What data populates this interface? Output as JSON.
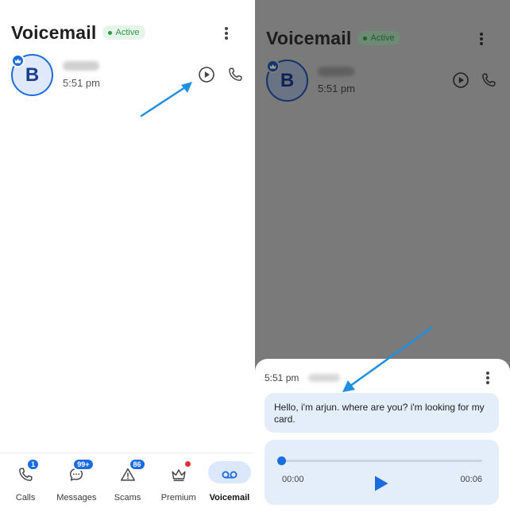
{
  "left_screen": {
    "header": {
      "title": "Voicemail",
      "status_badge": "Active"
    },
    "voicemail_item": {
      "avatar_initial": "B",
      "time": "5:51 pm"
    },
    "tabs": [
      {
        "label": "Calls",
        "badge": "1"
      },
      {
        "label": "Messages",
        "badge": "99+"
      },
      {
        "label": "Scams",
        "badge": "86"
      },
      {
        "label": "Premium"
      },
      {
        "label": "Voicemail",
        "active": true
      }
    ]
  },
  "right_screen": {
    "header": {
      "title": "Voicemail",
      "status_badge": "Active"
    },
    "voicemail_item": {
      "avatar_initial": "B",
      "time": "5:51 pm"
    },
    "sheet": {
      "time": "5:51 pm",
      "transcript": "Hello, i'm arjun. where are you? i'm looking for my card.",
      "player": {
        "current_time": "00:00",
        "duration": "00:06",
        "progress": 0
      }
    }
  },
  "colors": {
    "accent": "#1a6ce0",
    "active_green": "#2e9a48",
    "annotation_arrow": "#1f8fe0"
  },
  "icons": [
    "more-vert-icon",
    "crown-icon",
    "play-circle-icon",
    "phone-icon",
    "messages-icon",
    "scam-warning-icon",
    "voicemail-icon",
    "play-icon"
  ]
}
